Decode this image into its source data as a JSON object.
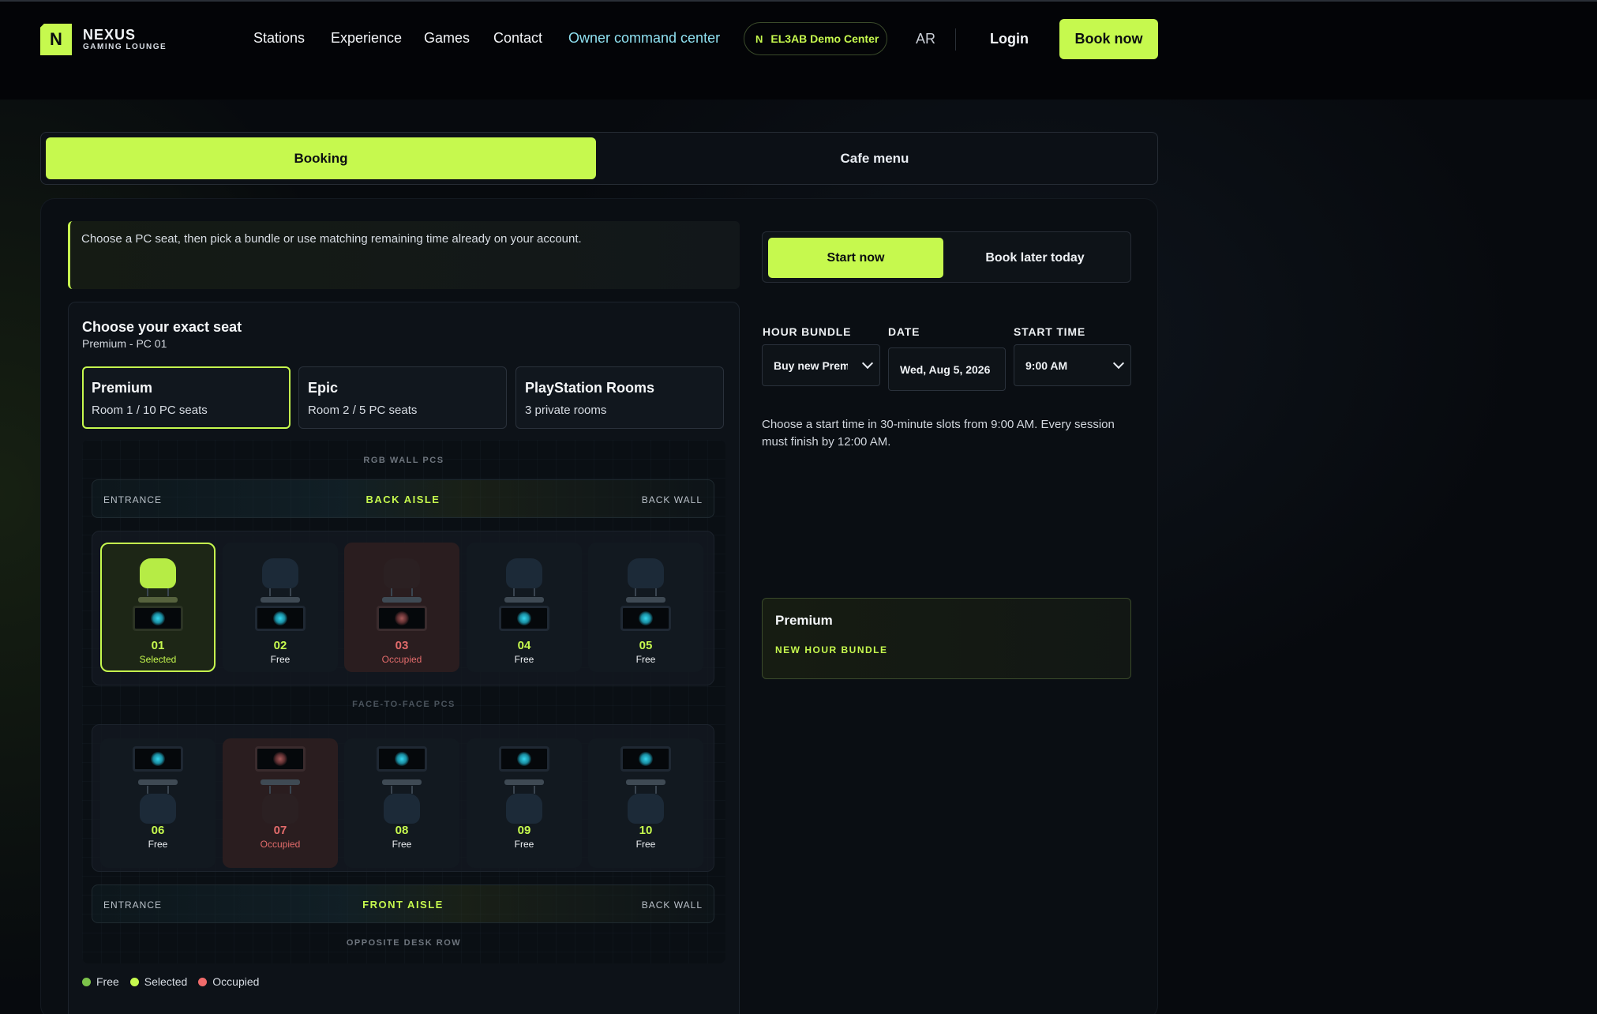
{
  "brand": {
    "logo_letter": "N",
    "name": "NEXUS",
    "tagline": "GAMING LOUNGE",
    "accent": "#c6f94e"
  },
  "nav": {
    "items": [
      "Stations",
      "Experience",
      "Games",
      "Contact",
      "Owner command center"
    ],
    "demo_letter": "N",
    "demo_center": "EL3AB Demo Center",
    "lang": "AR",
    "login": "Login",
    "book_now": "Book now"
  },
  "tabs": {
    "booking": "Booking",
    "cafe": "Cafe menu"
  },
  "info_text": "Choose a PC seat, then pick a bundle or use matching remaining time already on your account.",
  "seat_picker": {
    "title": "Choose your exact seat",
    "subtitle": "Premium - PC 01",
    "rooms": [
      {
        "name": "Premium",
        "detail": "Room 1 / 10 PC seats",
        "active": true
      },
      {
        "name": "Epic",
        "detail": "Room 2 / 5 PC seats",
        "active": false
      },
      {
        "name": "PlayStation Rooms",
        "detail": "3 private rooms",
        "active": false
      }
    ],
    "map": {
      "top_label": "RGB WALL PCS",
      "back_aisle": {
        "left": "ENTRANCE",
        "center": "BACK AISLE",
        "right": "BACK WALL"
      },
      "middle_label": "FACE-TO-FACE PCS",
      "front_aisle": {
        "left": "ENTRANCE",
        "center": "FRONT AISLE",
        "right": "BACK WALL"
      },
      "bottom_label": "OPPOSITE DESK ROW",
      "row1": [
        {
          "num": "01",
          "state": "Selected"
        },
        {
          "num": "02",
          "state": "Free"
        },
        {
          "num": "03",
          "state": "Occupied"
        },
        {
          "num": "04",
          "state": "Free"
        },
        {
          "num": "05",
          "state": "Free"
        }
      ],
      "row2": [
        {
          "num": "06",
          "state": "Free"
        },
        {
          "num": "07",
          "state": "Occupied"
        },
        {
          "num": "08",
          "state": "Free"
        },
        {
          "num": "09",
          "state": "Free"
        },
        {
          "num": "10",
          "state": "Free"
        }
      ]
    },
    "legend": [
      {
        "label": "Free",
        "color": "#7cc24a"
      },
      {
        "label": "Selected",
        "color": "#c6f94e"
      },
      {
        "label": "Occupied",
        "color": "#f06b6b"
      }
    ]
  },
  "booking": {
    "mode_start": "Start now",
    "mode_later": "Book later today",
    "hour_bundle_label": "HOUR BUNDLE",
    "hour_bundle_value": "Buy new Premium",
    "date_label": "DATE",
    "date_value": "Wed, Aug 5, 2026",
    "start_time_label": "START TIME",
    "start_time_value": "9:00 AM",
    "hint": "Choose a start time in 30-minute slots from 9:00 AM. Every session must finish by 12:00 AM.",
    "summary_title": "Premium",
    "summary_sub": "NEW HOUR BUNDLE"
  }
}
